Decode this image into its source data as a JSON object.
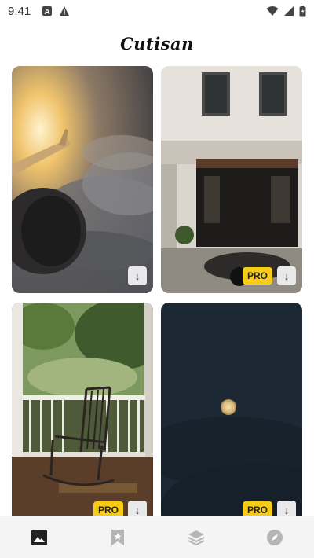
{
  "status_bar": {
    "time": "9:41",
    "left_icons": [
      "a-badge-icon",
      "warning-icon"
    ],
    "right_icons": [
      "wifi-icon",
      "signal-icon",
      "battery-icon"
    ]
  },
  "header": {
    "logo_text": "Cutisan"
  },
  "cards": [
    {
      "subject": "airplane-wing-over-clouds",
      "pro": false,
      "download_icon": "↓"
    },
    {
      "subject": "storefront-with-scooter",
      "pro": true,
      "pro_label": "PRO",
      "download_icon": "↓"
    },
    {
      "subject": "rocking-chair-on-porch",
      "pro": true,
      "pro_label": "PRO",
      "download_icon": "↓"
    },
    {
      "subject": "moon-night-sky",
      "pro": true,
      "pro_label": "PRO",
      "download_icon": "↓"
    }
  ],
  "bottom_nav": {
    "items": [
      {
        "name": "wallpapers",
        "icon": "image-icon",
        "active": true
      },
      {
        "name": "favorites",
        "icon": "bookmark-star-icon",
        "active": false
      },
      {
        "name": "collections",
        "icon": "layers-icon",
        "active": false
      },
      {
        "name": "explore",
        "icon": "compass-icon",
        "active": false
      }
    ]
  },
  "colors": {
    "pro_badge": "#f7cc12",
    "nav_active": "#222222",
    "nav_inactive": "#b5b5b5"
  }
}
